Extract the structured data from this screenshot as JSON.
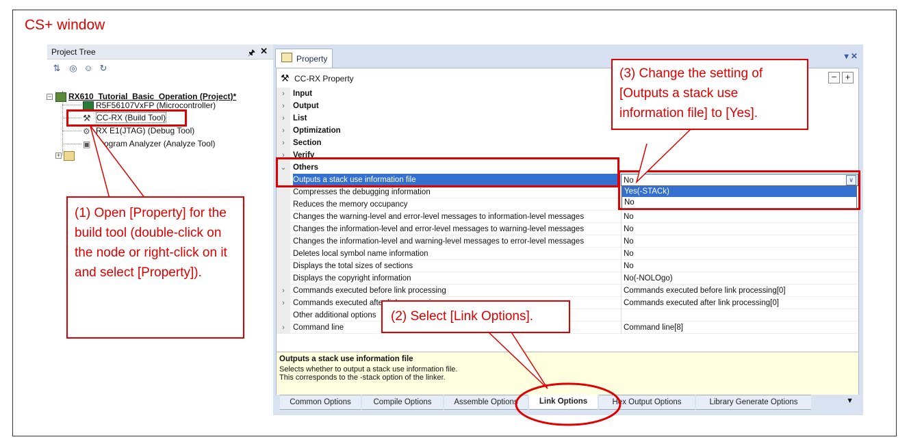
{
  "caption": "CS+ window",
  "project_tree": {
    "title": "Project Tree",
    "pin": "⎀",
    "close": "✕",
    "items": [
      {
        "label": "RX610_Tutorial_Basic_Operation (Project)*"
      },
      {
        "label": "R5F56107VxFP (Microcontroller)"
      },
      {
        "label": "CC-RX (Build Tool)"
      },
      {
        "label": "RX E1(JTAG) (Debug Tool)"
      },
      {
        "label": "Program Analyzer (Analyze Tool)"
      }
    ]
  },
  "property": {
    "tab_label": "Property",
    "window_controls": "▾ ✕",
    "header_label": "CC-RX Property",
    "categories": [
      "Input",
      "Output",
      "List",
      "Optimization",
      "Section",
      "Verify",
      "Others"
    ],
    "rows": [
      {
        "name": "Outputs a stack use information file",
        "value": "No"
      },
      {
        "name": "Compresses the debugging information",
        "value": ""
      },
      {
        "name": "Reduces the memory occupancy",
        "value": ""
      },
      {
        "name": "Changes the warning-level and error-level messages to information-level messages",
        "value": "No"
      },
      {
        "name": "Changes the information-level and error-level messages to warning-level messages",
        "value": "No"
      },
      {
        "name": "Changes the information-level and warning-level messages to error-level messages",
        "value": "No"
      },
      {
        "name": "Deletes local symbol name information",
        "value": "No"
      },
      {
        "name": "Displays the total sizes of sections",
        "value": "No"
      },
      {
        "name": "Displays the copyright information",
        "value": "No(-NOLOgo)"
      },
      {
        "name": "Commands executed before link processing",
        "value": "Commands executed before link processing[0]"
      },
      {
        "name": "Commands executed after link processing",
        "value": "Commands executed after link processing[0]"
      },
      {
        "name": "Other additional options",
        "value": ""
      },
      {
        "name": "Command line",
        "value": "Command line[8]"
      }
    ],
    "dropdown_options": [
      "Yes(-STACk)",
      "No"
    ],
    "description": {
      "title": "Outputs a stack use information file",
      "line1": "Selects whether to output a stack use information file.",
      "line2": "This corresponds to the -stack option of the linker."
    },
    "bottom_tabs": [
      "Common Options",
      "Compile Options",
      "Assemble Options",
      "Link Options",
      "Hex Output Options",
      "Library Generate Options"
    ],
    "active_tab": "Link Options"
  },
  "annotations": {
    "note1": "(1) Open [Property] for the build tool (double-click on the node or right-click on it and select [Property]).",
    "note2": "(2) Select [Link Options].",
    "note3": "(3) Change the setting of [Outputs a stack use information file] to [Yes]."
  },
  "colors": {
    "annotation": "#e00000",
    "selection": "#3470d0",
    "description_bg": "#ffffe0"
  }
}
